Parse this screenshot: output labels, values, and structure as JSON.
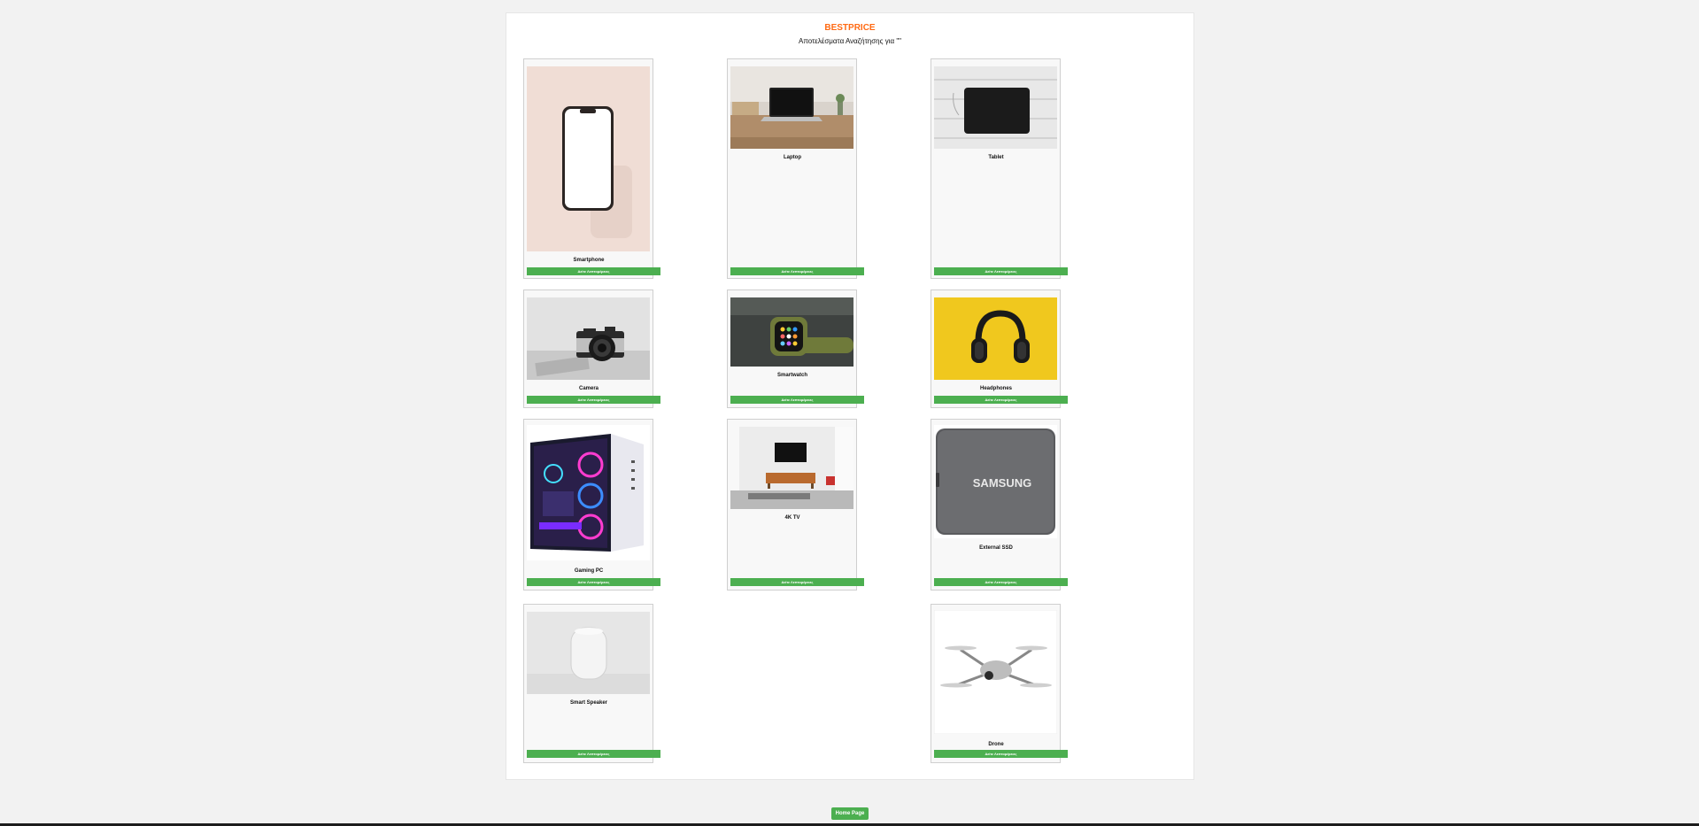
{
  "header": {
    "brand": "BESTPRICE",
    "subtitle": "Αποτελέσματα Αναζήτησης για \"\""
  },
  "products": [
    {
      "name": "Smartphone",
      "button": "Δείτε Λεπτομέρειες",
      "icon": "smartphone-image"
    },
    {
      "name": "Laptop",
      "button": "Δείτε Λεπτομέρειες",
      "icon": "laptop-image"
    },
    {
      "name": "Tablet",
      "button": "Δείτε Λεπτομέρειες",
      "icon": "tablet-image"
    },
    {
      "name": "Camera",
      "button": "Δείτε Λεπτομέρειες",
      "icon": "camera-image"
    },
    {
      "name": "Smartwatch",
      "button": "Δείτε Λεπτομέρειες",
      "icon": "smartwatch-image"
    },
    {
      "name": "Headphones",
      "button": "Δείτε Λεπτομέρειες",
      "icon": "headphones-image"
    },
    {
      "name": "Gaming PC",
      "button": "Δείτε Λεπτομέρειες",
      "icon": "gaming-pc-image"
    },
    {
      "name": "4K TV",
      "button": "Δείτε Λεπτομέρειες",
      "icon": "tv-image"
    },
    {
      "name": "External SSD",
      "button": "Δείτε Λεπτομέρειες",
      "icon": "ssd-image"
    },
    {
      "name": "Smart Speaker",
      "button": "Δείτε Λεπτομέρειες",
      "icon": "speaker-image"
    },
    {
      "name": "Drone",
      "button": "Δείτε Λεπτομέρειες",
      "icon": "drone-image"
    }
  ],
  "ssd_logo": "SAMSUNG",
  "footer": {
    "home_label": "Home Page"
  },
  "colors": {
    "brand": "#ff6a13",
    "button": "#4caf50",
    "panel": "#ffffff",
    "page": "#f2f2f2"
  }
}
